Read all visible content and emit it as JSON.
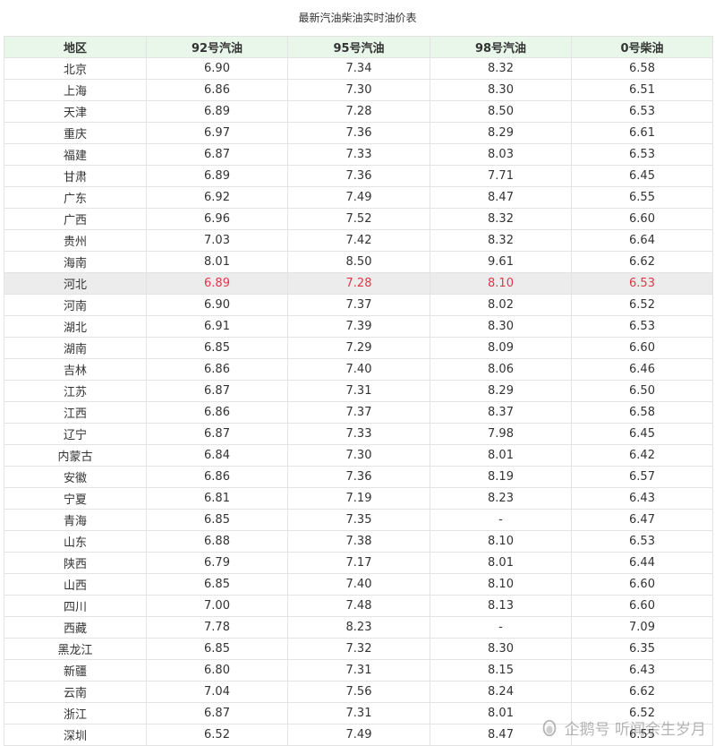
{
  "caption": "最新汽油柴油实时油价表",
  "columns": [
    "地区",
    "92号汽油",
    "95号汽油",
    "98号汽油",
    "0号柴油"
  ],
  "highlight_row": "河北",
  "colors": {
    "header_bg": "#e9f7ea",
    "highlight_bg": "#ececec",
    "highlight_text": "#e0374a"
  },
  "rows": [
    [
      "北京",
      "6.90",
      "7.34",
      "8.32",
      "6.58"
    ],
    [
      "上海",
      "6.86",
      "7.30",
      "8.30",
      "6.51"
    ],
    [
      "天津",
      "6.89",
      "7.28",
      "8.50",
      "6.53"
    ],
    [
      "重庆",
      "6.97",
      "7.36",
      "8.29",
      "6.61"
    ],
    [
      "福建",
      "6.87",
      "7.33",
      "8.03",
      "6.53"
    ],
    [
      "甘肃",
      "6.89",
      "7.36",
      "7.71",
      "6.45"
    ],
    [
      "广东",
      "6.92",
      "7.49",
      "8.47",
      "6.55"
    ],
    [
      "广西",
      "6.96",
      "7.52",
      "8.32",
      "6.60"
    ],
    [
      "贵州",
      "7.03",
      "7.42",
      "8.32",
      "6.64"
    ],
    [
      "海南",
      "8.01",
      "8.50",
      "9.61",
      "6.62"
    ],
    [
      "河北",
      "6.89",
      "7.28",
      "8.10",
      "6.53"
    ],
    [
      "河南",
      "6.90",
      "7.37",
      "8.02",
      "6.52"
    ],
    [
      "湖北",
      "6.91",
      "7.39",
      "8.30",
      "6.53"
    ],
    [
      "湖南",
      "6.85",
      "7.29",
      "8.09",
      "6.60"
    ],
    [
      "吉林",
      "6.86",
      "7.40",
      "8.06",
      "6.46"
    ],
    [
      "江苏",
      "6.87",
      "7.31",
      "8.29",
      "6.50"
    ],
    [
      "江西",
      "6.86",
      "7.37",
      "8.37",
      "6.58"
    ],
    [
      "辽宁",
      "6.87",
      "7.33",
      "7.98",
      "6.45"
    ],
    [
      "内蒙古",
      "6.84",
      "7.30",
      "8.01",
      "6.42"
    ],
    [
      "安徽",
      "6.86",
      "7.36",
      "8.19",
      "6.57"
    ],
    [
      "宁夏",
      "6.81",
      "7.19",
      "8.23",
      "6.43"
    ],
    [
      "青海",
      "6.85",
      "7.35",
      "-",
      "6.47"
    ],
    [
      "山东",
      "6.88",
      "7.38",
      "8.10",
      "6.53"
    ],
    [
      "陕西",
      "6.79",
      "7.17",
      "8.01",
      "6.44"
    ],
    [
      "山西",
      "6.85",
      "7.40",
      "8.10",
      "6.60"
    ],
    [
      "四川",
      "7.00",
      "7.48",
      "8.13",
      "6.60"
    ],
    [
      "西藏",
      "7.78",
      "8.23",
      "-",
      "7.09"
    ],
    [
      "黑龙江",
      "6.85",
      "7.32",
      "8.30",
      "6.35"
    ],
    [
      "新疆",
      "6.80",
      "7.31",
      "8.15",
      "6.43"
    ],
    [
      "云南",
      "7.04",
      "7.56",
      "8.24",
      "6.62"
    ],
    [
      "浙江",
      "6.87",
      "7.31",
      "8.01",
      "6.52"
    ],
    [
      "深圳",
      "6.52",
      "7.49",
      "8.47",
      "6.55"
    ]
  ],
  "watermark": {
    "text": "企鹅号 听闻余生岁月",
    "icon": "penguin-logo-icon"
  }
}
